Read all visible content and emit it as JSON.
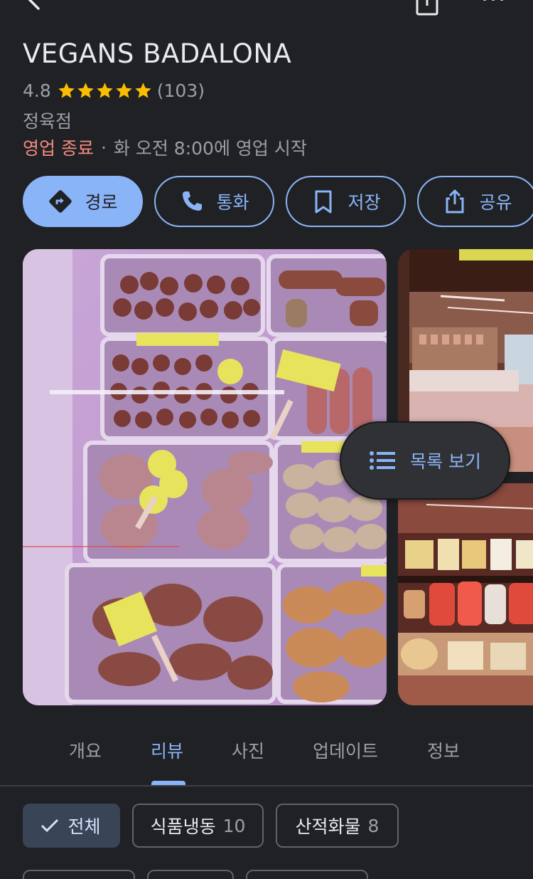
{
  "place": {
    "name": "VEGANS BADALONA",
    "rating": "4.8",
    "review_count": "(103)",
    "stars": 5,
    "category": "정육점",
    "status_closed": "영업 종료",
    "dot": "·",
    "opens": "화 오전 8:00에 영업 시작"
  },
  "actions": {
    "route": "경로",
    "call": "통화",
    "save": "저장",
    "share": "공유"
  },
  "photos": {
    "list_view_label": "목록 보기"
  },
  "tabs": [
    {
      "label": "개요",
      "active": false
    },
    {
      "label": "리뷰",
      "active": true
    },
    {
      "label": "사진",
      "active": false
    },
    {
      "label": "업데이트",
      "active": false
    },
    {
      "label": "정보",
      "active": false
    }
  ],
  "filters": [
    {
      "label": "전체",
      "count": "",
      "selected": true
    },
    {
      "label": "식품냉동",
      "count": "10",
      "selected": false
    },
    {
      "label": "산적화물",
      "count": "8",
      "selected": false
    }
  ],
  "colors": {
    "background": "#202124",
    "accent": "#8ab4f8",
    "closed": "#f28b82",
    "star": "#fbbc04",
    "secondary_text": "#9aa0a6"
  },
  "icons": [
    "back-icon",
    "share-icon",
    "more-icon",
    "star-icon",
    "directions-icon",
    "phone-icon",
    "bookmark-icon",
    "list-icon",
    "check-icon"
  ]
}
